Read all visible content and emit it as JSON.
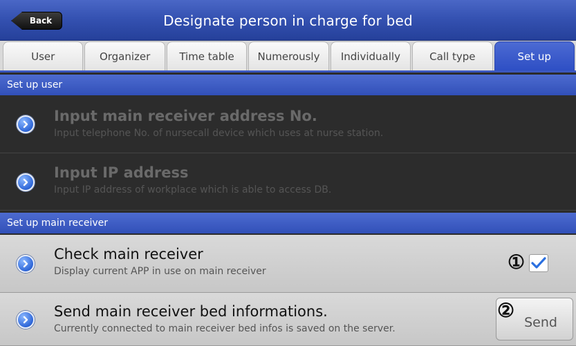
{
  "header": {
    "back_label": "Back",
    "title": "Designate person in charge for bed"
  },
  "tabs": [
    {
      "label": "User",
      "active": false
    },
    {
      "label": "Organizer",
      "active": false
    },
    {
      "label": "Time table",
      "active": false
    },
    {
      "label": "Numerously",
      "active": false
    },
    {
      "label": "Individually",
      "active": false
    },
    {
      "label": "Call type",
      "active": false
    },
    {
      "label": "Set up",
      "active": true
    }
  ],
  "sections": {
    "user": {
      "header": "Set up user",
      "items": [
        {
          "title": "Input main receiver address No.",
          "subtitle": "Input telephone No. of nursecall device which uses at nurse station."
        },
        {
          "title": "Input IP address",
          "subtitle": "Input IP address of workplace which is able to access DB."
        }
      ]
    },
    "main_receiver": {
      "header": "Set up main receiver",
      "items": [
        {
          "title": "Check main receiver",
          "subtitle": "Display current APP in use on main receiver",
          "checked": true
        },
        {
          "title": "Send main receiver bed informations.",
          "subtitle": "Currently connected to main receiver bed infos is saved on the server."
        }
      ]
    }
  },
  "annotations": {
    "marker_1": "①",
    "marker_2": "②"
  },
  "send_label": "Send",
  "icons": {
    "row_icon": "chevron-right-circle-icon",
    "check_icon": "checkmark-icon"
  },
  "colors": {
    "accent": "#3552b2",
    "tab_active": "#2e4fc4",
    "check": "#2a6fe0"
  }
}
